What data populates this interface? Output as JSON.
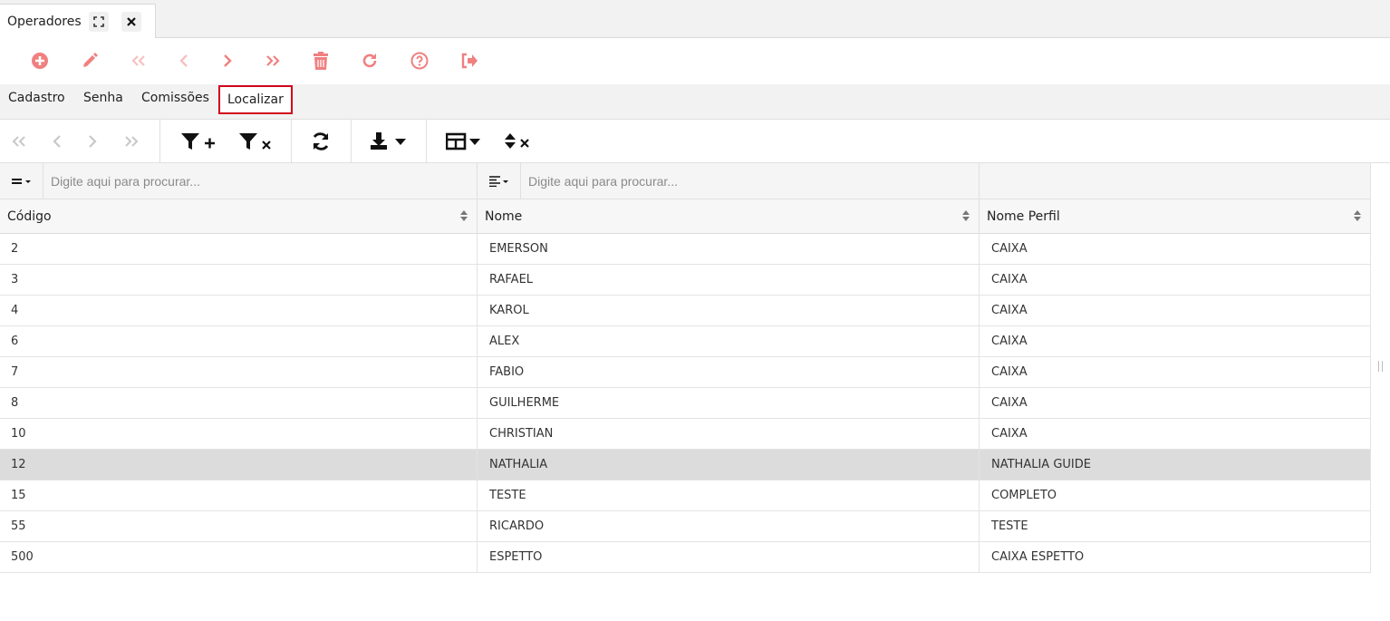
{
  "doc_tab": {
    "title": "Operadores"
  },
  "action_icons": [
    "add-circle-icon",
    "edit-pencil-icon",
    "first-record-icon",
    "previous-record-icon",
    "next-record-icon",
    "last-record-icon",
    "delete-trash-icon",
    "redo-icon",
    "help-icon",
    "exit-icon"
  ],
  "form_tabs": [
    "Cadastro",
    "Senha",
    "Comissões",
    "Localizar"
  ],
  "active_tab": "Localizar",
  "grid": {
    "filters": [
      {
        "placeholder": "Digite aqui para procurar..."
      },
      {
        "placeholder": "Digite aqui para procurar..."
      }
    ],
    "columns": [
      "Código",
      "Nome",
      "Nome Perfil"
    ],
    "rows": [
      [
        "2",
        "EMERSON",
        "CAIXA"
      ],
      [
        "3",
        "RAFAEL",
        "CAIXA"
      ],
      [
        "4",
        "KAROL",
        "CAIXA"
      ],
      [
        "6",
        "ALEX",
        "CAIXA"
      ],
      [
        "7",
        "FABIO",
        "CAIXA"
      ],
      [
        "8",
        "GUILHERME",
        "CAIXA"
      ],
      [
        "10",
        "CHRISTIAN",
        "CAIXA"
      ],
      [
        "12",
        "NATHALIA",
        "NATHALIA GUIDE"
      ],
      [
        "15",
        "TESTE",
        "COMPLETO"
      ],
      [
        "55",
        "RICARDO",
        "TESTE"
      ],
      [
        "500",
        "ESPETTO",
        "CAIXA ESPETTO"
      ]
    ],
    "selected_row": 7
  },
  "colors": {
    "accent": "#f08080",
    "active_tab_border": "#d0021b",
    "selected_row": "#dcdcdc"
  }
}
